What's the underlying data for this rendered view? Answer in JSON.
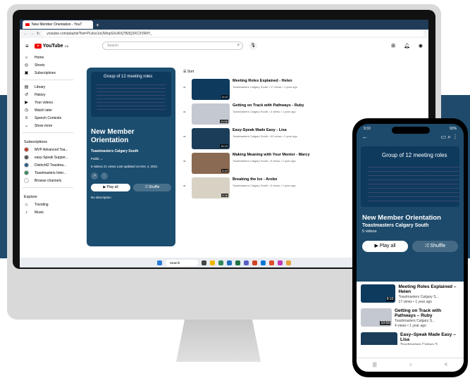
{
  "browser": {
    "tab_title": "New Member Orientation - YouT",
    "new_tab": "+",
    "url": "youtube.com/playlist?list=PLdoo1otJWopSXvRXjTB3Q3XC3VR9Y_"
  },
  "youtube": {
    "logo": "YouTube",
    "country": "CA",
    "search_placeholder": "Search"
  },
  "sidebar": {
    "main": [
      {
        "label": "Home",
        "icon": "home-icon",
        "glyph": "⌂"
      },
      {
        "label": "Shorts",
        "icon": "shorts-icon",
        "glyph": "◎"
      },
      {
        "label": "Subscriptions",
        "icon": "subscriptions-icon",
        "glyph": "▣"
      }
    ],
    "library": [
      {
        "label": "Library",
        "icon": "library-icon",
        "glyph": "▤"
      },
      {
        "label": "History",
        "icon": "history-icon",
        "glyph": "↺"
      },
      {
        "label": "Your videos",
        "icon": "your-videos-icon",
        "glyph": "▶"
      },
      {
        "label": "Watch later",
        "icon": "watch-later-icon",
        "glyph": "◷"
      },
      {
        "label": "Speech Contests",
        "icon": "playlist-icon",
        "glyph": "≡"
      },
      {
        "label": "Show more",
        "icon": "chevron-down-icon",
        "glyph": "⌄"
      }
    ],
    "subs_header": "Subscriptions",
    "subs": [
      {
        "label": "MVP Advanced Toa...",
        "color": "#c0392b"
      },
      {
        "label": "easy-Speak Suppor...",
        "color": "#555555"
      },
      {
        "label": "District42 Toastma...",
        "color": "#2c5f8a"
      },
      {
        "label": "Toastmasters Inter...",
        "color": "#3a8a5a"
      },
      {
        "label": "Browse channels",
        "color": "#ffffff"
      }
    ],
    "explore_header": "Explore",
    "explore": [
      {
        "label": "Trending",
        "glyph": "♨"
      },
      {
        "label": "Music",
        "glyph": "♪"
      }
    ]
  },
  "playlist": {
    "slide_title": "Group of 12 meeting roles",
    "title": "New Member Orientation",
    "channel": "Toastmasters Calgary South",
    "visibility": "Public",
    "meta": "5 videos  21 views  Last updated on Dec 4, 2021",
    "play_all": "▶  Play all",
    "shuffle": "⤮  Shuffle",
    "description": "No description",
    "sort": "Sort"
  },
  "videos": [
    {
      "title": "Meeting Roles Explained - Helen",
      "meta": "Toastmasters Calgary South • 17 views • 1 year ago",
      "duration": "8:10",
      "color": "#0e3a5e"
    },
    {
      "title": "Getting on Track with Pathways - Ruby",
      "meta": "Toastmasters Calgary South • 4 views • 1 year ago",
      "duration": "10:58",
      "color": "#c4c8d0"
    },
    {
      "title": "Easy-Speak Made Easy - Lisa",
      "meta": "Toastmasters Calgary South • 42 views • 1 year ago",
      "duration": "15:15",
      "color": "#1b3d5a"
    },
    {
      "title": "Making Meaning with Your Mentor - Marcy",
      "meta": "Toastmasters Calgary South • 5 views • 1 year ago",
      "duration": "6:43",
      "color": "#8a6a52"
    },
    {
      "title": "Breaking the Ice - Arobo",
      "meta": "Toastmasters Calgary South • 5 views • 1 year ago",
      "duration": "5:38",
      "color": "#d8d2c4"
    }
  ],
  "taskbar": {
    "search": "Search"
  },
  "phone": {
    "time": "9:33",
    "battery": "92%",
    "slide_title": "Group of 12 meeting roles",
    "title": "New Member Orientation",
    "channel": "Toastmasters Calgary South",
    "count": "5 videos",
    "play_all": "▶  Play all",
    "shuffle": "⤮  Shuffle",
    "videos": [
      {
        "title": "Meeting Roles Explained – Helen",
        "channel": "Toastmasters Calgary S...",
        "meta": "17 views • 1 year ago",
        "duration": "8:10",
        "color": "#0e3a5e"
      },
      {
        "title": "Getting on Track with Pathways – Ruby",
        "channel": "Toastmasters Calgary S...",
        "meta": "4 views • 1 year ago",
        "duration": "10:58",
        "color": "#c4c8d0"
      },
      {
        "title": "Easy–Speak Made Easy – Lisa",
        "channel": "Toastmasters Calgary S...",
        "meta": "",
        "duration": "",
        "color": "#1b3d5a"
      }
    ],
    "nav": [
      {
        "label": "Home",
        "glyph": "⌂"
      },
      {
        "label": "Shorts",
        "glyph": "◎"
      },
      {
        "label": "",
        "glyph": "⊕"
      },
      {
        "label": "Subscriptions",
        "glyph": "▣"
      },
      {
        "label": "Library",
        "glyph": "▤"
      }
    ],
    "sys": [
      "|||",
      "○",
      "<"
    ]
  }
}
